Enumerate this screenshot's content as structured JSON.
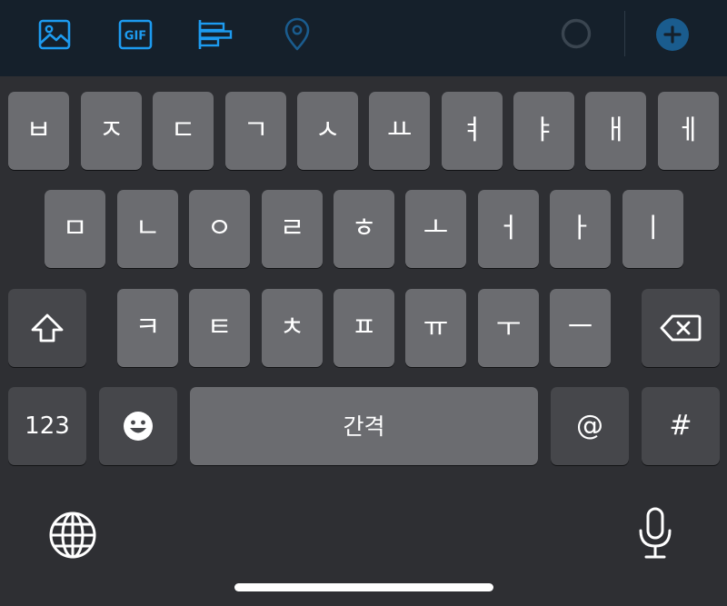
{
  "toolbar": {
    "icons": [
      "image-icon",
      "gif-icon",
      "poll-icon",
      "location-icon",
      "char-count-ring-icon",
      "add-icon"
    ],
    "gif_label": "GIF",
    "accent": "#1d9bf0"
  },
  "keyboard": {
    "row1": [
      "ㅂ",
      "ㅈ",
      "ㄷ",
      "ㄱ",
      "ㅅ",
      "ㅛ",
      "ㅕ",
      "ㅑ",
      "ㅐ",
      "ㅔ"
    ],
    "row2": [
      "ㅁ",
      "ㄴ",
      "ㅇ",
      "ㄹ",
      "ㅎ",
      "ㅗ",
      "ㅓ",
      "ㅏ",
      "ㅣ"
    ],
    "row3": [
      "ㅋ",
      "ㅌ",
      "ㅊ",
      "ㅍ",
      "ㅠ",
      "ㅜ",
      "ㅡ"
    ],
    "numbers_label": "123",
    "space_label": "간격",
    "at_label": "@",
    "hash_label": "#",
    "shift_icon": "shift-icon",
    "backspace_icon": "backspace-icon",
    "emoji_icon": "emoji-icon",
    "globe_icon": "globe-icon",
    "mic_icon": "microphone-icon",
    "key_color": "#6b6c70",
    "dark_key_color": "#46474b",
    "background_color": "#2e2f33"
  }
}
